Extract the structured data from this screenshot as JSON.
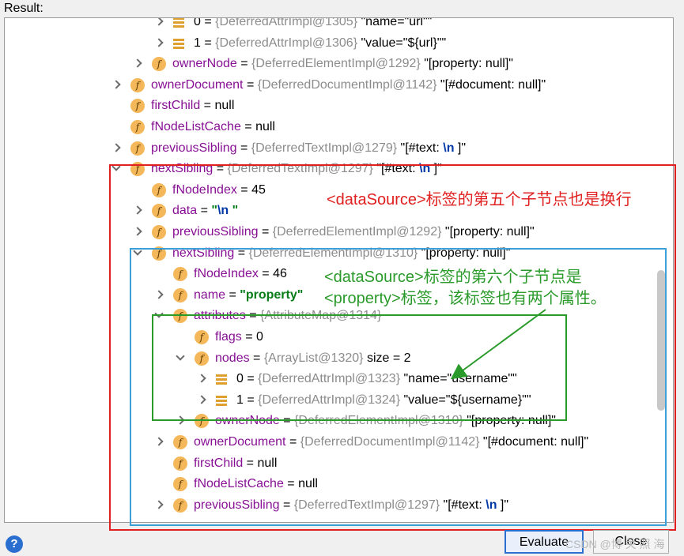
{
  "header": {
    "result_label": "Result:"
  },
  "tree": [
    {
      "indent": 192,
      "chev": "right",
      "icon": "list",
      "name": "0",
      "ref": "{DeferredAttrImpl@1305}",
      "val": "\"name=\"url\"\""
    },
    {
      "indent": 192,
      "chev": "right",
      "icon": "list",
      "name": "1",
      "ref": "{DeferredAttrImpl@1306}",
      "val": "\"value=\"${url}\"\""
    },
    {
      "indent": 165,
      "chev": "right",
      "icon": "f",
      "name": "ownerNode",
      "ref": "{DeferredElementImpl@1292}",
      "val": "\"[property: null]\""
    },
    {
      "indent": 138,
      "chev": "right",
      "icon": "f",
      "name": "ownerDocument",
      "ref": "{DeferredDocumentImpl@1142}",
      "val": "\"[#document: null]\""
    },
    {
      "indent": 138,
      "chev": "",
      "icon": "f",
      "name": "firstChild",
      "ref": "",
      "val": "null"
    },
    {
      "indent": 138,
      "chev": "",
      "icon": "f",
      "name": "fNodeListCache",
      "ref": "",
      "val": "null"
    },
    {
      "indent": 138,
      "chev": "right",
      "icon": "f",
      "name": "previousSibling",
      "ref": "{DeferredTextImpl@1279}",
      "val": "\"[#text: ",
      "esc": "\\n",
      "tail": "               ]\""
    },
    {
      "indent": 138,
      "chev": "down",
      "icon": "f",
      "name": "nextSibling",
      "ref": "{DeferredTextImpl@1297}",
      "val": "\"[#text: ",
      "esc": "\\n",
      "tail": "               ]\""
    },
    {
      "indent": 165,
      "chev": "",
      "icon": "f",
      "name": "fNodeIndex",
      "ref": "",
      "val": "45"
    },
    {
      "indent": 165,
      "chev": "right",
      "icon": "f",
      "name": "data",
      "ref": "",
      "strval": "\"",
      "esc": "\\n",
      "strtail": "               \""
    },
    {
      "indent": 165,
      "chev": "right",
      "icon": "f",
      "name": "previousSibling",
      "ref": "{DeferredElementImpl@1292}",
      "val": "\"[property: null]\""
    },
    {
      "indent": 165,
      "chev": "down",
      "icon": "f",
      "name": "nextSibling",
      "ref": "{DeferredElementImpl@1310}",
      "val": "\"[property: null]\""
    },
    {
      "indent": 192,
      "chev": "",
      "icon": "f",
      "name": "fNodeIndex",
      "ref": "",
      "val": "46"
    },
    {
      "indent": 192,
      "chev": "right",
      "icon": "f",
      "name": "name",
      "ref": "",
      "strval": "\"property\""
    },
    {
      "indent": 192,
      "chev": "down",
      "icon": "f",
      "name": "attributes",
      "ref": "{AttributeMap@1314}",
      "val": ""
    },
    {
      "indent": 219,
      "chev": "",
      "icon": "f",
      "name": "flags",
      "ref": "",
      "val": "0"
    },
    {
      "indent": 219,
      "chev": "down",
      "icon": "f",
      "name": "nodes",
      "ref": "{ArrayList@1320}",
      "val": " size = 2"
    },
    {
      "indent": 246,
      "chev": "right",
      "icon": "list",
      "name": "0",
      "ref": "{DeferredAttrImpl@1323}",
      "val": "\"name=\"username\"\""
    },
    {
      "indent": 246,
      "chev": "right",
      "icon": "list",
      "name": "1",
      "ref": "{DeferredAttrImpl@1324}",
      "val": "\"value=\"${username}\"\""
    },
    {
      "indent": 219,
      "chev": "right",
      "icon": "f",
      "name": "ownerNode",
      "ref": "{DeferredElementImpl@1310}",
      "val": "\"[property: null]\""
    },
    {
      "indent": 192,
      "chev": "right",
      "icon": "f",
      "name": "ownerDocument",
      "ref": "{DeferredDocumentImpl@1142}",
      "val": "\"[#document: null]\""
    },
    {
      "indent": 192,
      "chev": "",
      "icon": "f",
      "name": "firstChild",
      "ref": "",
      "val": "null"
    },
    {
      "indent": 192,
      "chev": "",
      "icon": "f",
      "name": "fNodeListCache",
      "ref": "",
      "val": "null"
    },
    {
      "indent": 192,
      "chev": "right",
      "icon": "f",
      "name": "previousSibling",
      "ref": "{DeferredTextImpl@1297}",
      "val": "\"[#text: ",
      "esc": "\\n",
      "tail": "               ]\""
    }
  ],
  "annotations": {
    "note1": "<dataSource>标签的第五个子节点也是换行",
    "note2_line1": "<dataSource>标签的第六个子节点是",
    "note2_line2": "<property>标签，该标签也有两个属性。"
  },
  "buttons": {
    "evaluate": "Evaluate",
    "close": "Close"
  },
  "help": "?",
  "watermark": "CSDN @博 关 照 海",
  "colors": {
    "red": "#e02020",
    "blue": "#3ca0d8",
    "green": "#2a9a2a",
    "field": "#871094"
  }
}
